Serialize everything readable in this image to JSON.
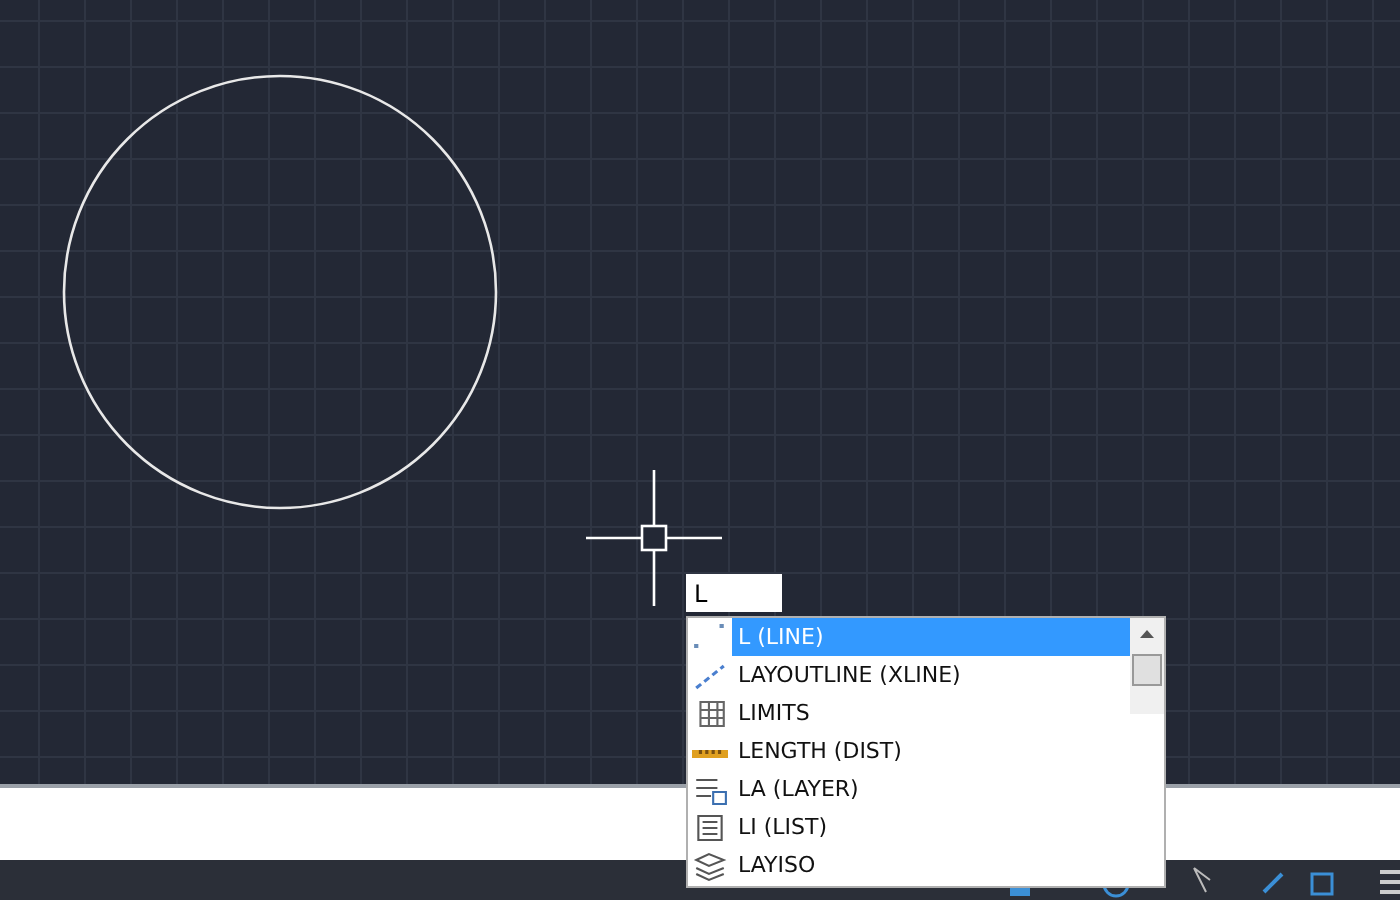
{
  "command_input": {
    "value": "L"
  },
  "autocomplete": {
    "items": [
      {
        "kind": "line",
        "label": "L (LINE)",
        "selected": true
      },
      {
        "kind": "xline",
        "label": "LAYOUTLINE (XLINE)",
        "selected": false
      },
      {
        "kind": "limits",
        "label": "LIMITS",
        "selected": false
      },
      {
        "kind": "dist",
        "label": "LENGTH (DIST)",
        "selected": false
      },
      {
        "kind": "layer",
        "label": "LA (LAYER)",
        "selected": false
      },
      {
        "kind": "list",
        "label": "LI (LIST)",
        "selected": false
      },
      {
        "kind": "layiso",
        "label": "LAYISO",
        "selected": false
      }
    ]
  }
}
